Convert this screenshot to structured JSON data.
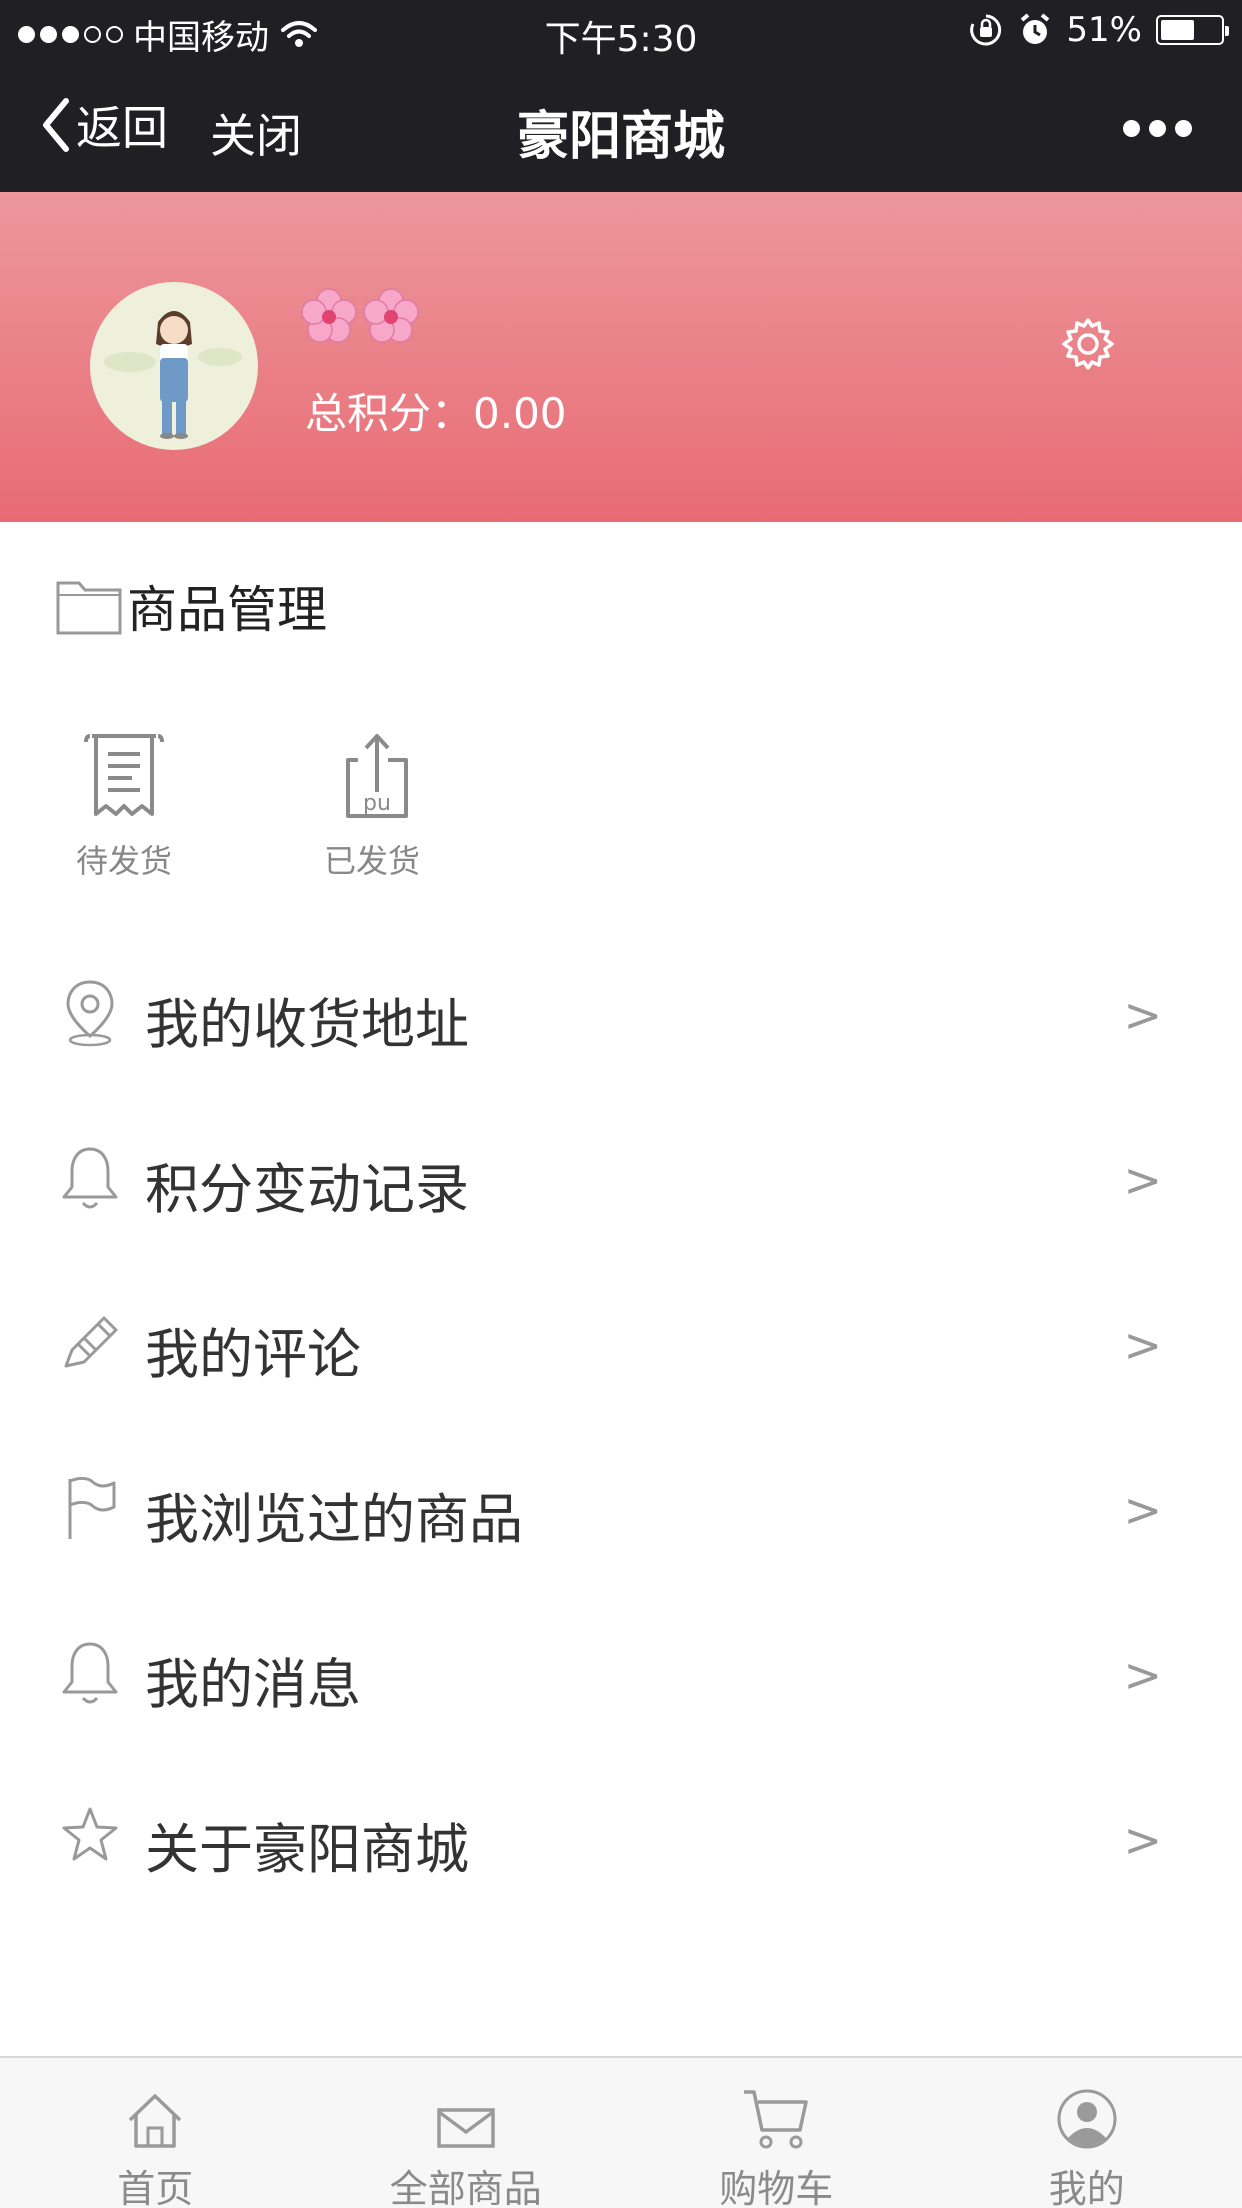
{
  "status_bar": {
    "carrier": "中国移动",
    "time": "下午5:30",
    "battery_text": "51%",
    "battery_level": 0.51
  },
  "nav": {
    "back_label": "返回",
    "close_label": "关闭",
    "title": "豪阳商城"
  },
  "profile": {
    "nickname": "🌸🌸",
    "points_label": "总积分：",
    "points_value": "0.00"
  },
  "section": {
    "title": "商品管理"
  },
  "orders": [
    {
      "label": "待发货",
      "icon": "receipt-icon"
    },
    {
      "label": "已发货",
      "icon": "upload-box-icon",
      "icon_text": "pu"
    }
  ],
  "menu": [
    {
      "label": "我的收货地址",
      "icon": "location-pin-icon",
      "chevron": ">"
    },
    {
      "label": "积分变动记录",
      "icon": "bell-icon",
      "chevron": ">"
    },
    {
      "label": "我的评论",
      "icon": "pencil-icon",
      "chevron": ">"
    },
    {
      "label": "我浏览过的商品",
      "icon": "flag-icon",
      "chevron": ">"
    },
    {
      "label": "我的消息",
      "icon": "bell-icon",
      "chevron": ">"
    },
    {
      "label": "关于豪阳商城",
      "icon": "star-icon",
      "chevron": ">"
    }
  ],
  "tabs": [
    {
      "label": "首页",
      "icon": "home-icon"
    },
    {
      "label": "全部商品",
      "icon": "envelope-icon"
    },
    {
      "label": "购物车",
      "icon": "cart-icon"
    },
    {
      "label": "我的",
      "icon": "user-icon"
    }
  ],
  "colors": {
    "header_top": "#ec979c",
    "header_bottom": "#e86b74",
    "nav_bg": "#1f1f24"
  }
}
